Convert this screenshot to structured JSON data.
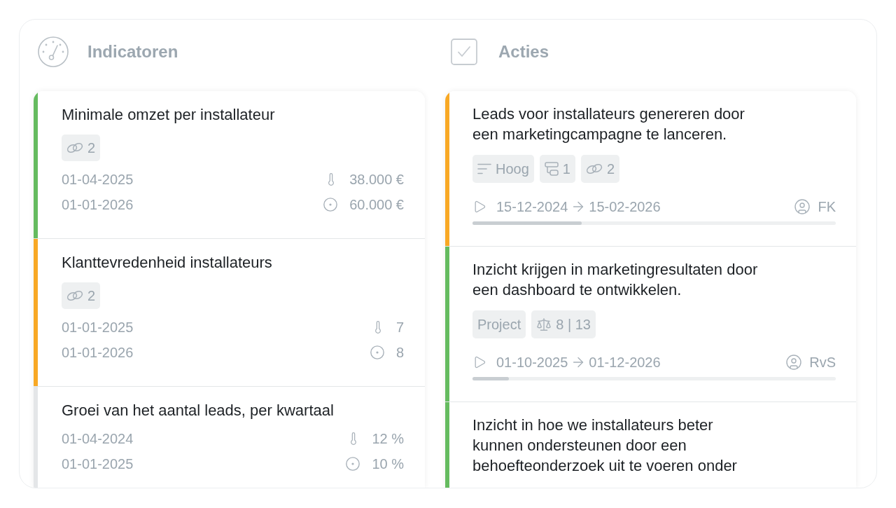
{
  "indicators": {
    "title": "Indicatoren",
    "items": [
      {
        "title": "Minimale omzet per installateur",
        "color": "#65bb5f",
        "badges": [
          {
            "kind": "links",
            "text": "2"
          }
        ],
        "rows": [
          {
            "kind": "current",
            "date": "01-04-2025",
            "value": "38.000 €"
          },
          {
            "kind": "target",
            "date": "01-01-2026",
            "value": "60.000 €"
          }
        ]
      },
      {
        "title": "Klanttevredenheid installateurs",
        "color": "#f8a824",
        "badges": [
          {
            "kind": "links",
            "text": "2"
          }
        ],
        "rows": [
          {
            "kind": "current",
            "date": "01-01-2025",
            "value": "7"
          },
          {
            "kind": "target",
            "date": "01-01-2026",
            "value": "8"
          }
        ]
      },
      {
        "title": "Groei van het aantal leads, per kwartaal",
        "color": "#e4e6e8",
        "rows": [
          {
            "kind": "current",
            "date": "01-04-2024",
            "value": "12 %"
          },
          {
            "kind": "target",
            "date": "01-01-2025",
            "value": "10 %"
          }
        ]
      }
    ]
  },
  "actions": {
    "title": "Acties",
    "items": [
      {
        "title": "Leads voor installateurs genereren door een marketingcampagne te lanceren.",
        "color": "#f8a824",
        "badges": [
          {
            "kind": "priority",
            "text": "Hoog"
          },
          {
            "kind": "subtasks",
            "text": "1"
          },
          {
            "kind": "links",
            "text": "2"
          }
        ],
        "start": "15-12-2024",
        "end": "15-02-2026",
        "owner": "FK",
        "level": 0.3
      },
      {
        "title": "Inzicht krijgen in marketingresultaten door een dashboard te ontwikkelen.",
        "color": "#65bb5f",
        "badges": [
          {
            "kind": "type",
            "text": "Project"
          },
          {
            "kind": "weight",
            "text": "8 | 13"
          }
        ],
        "start": "01-10-2025",
        "end": "01-12-2026",
        "owner": "RvS",
        "level": 0.1
      },
      {
        "title": "Inzicht in hoe we installateurs beter kunnen ondersteunen door een behoefteonderzoek uit te voeren onder",
        "color": "#65bb5f"
      }
    ]
  }
}
